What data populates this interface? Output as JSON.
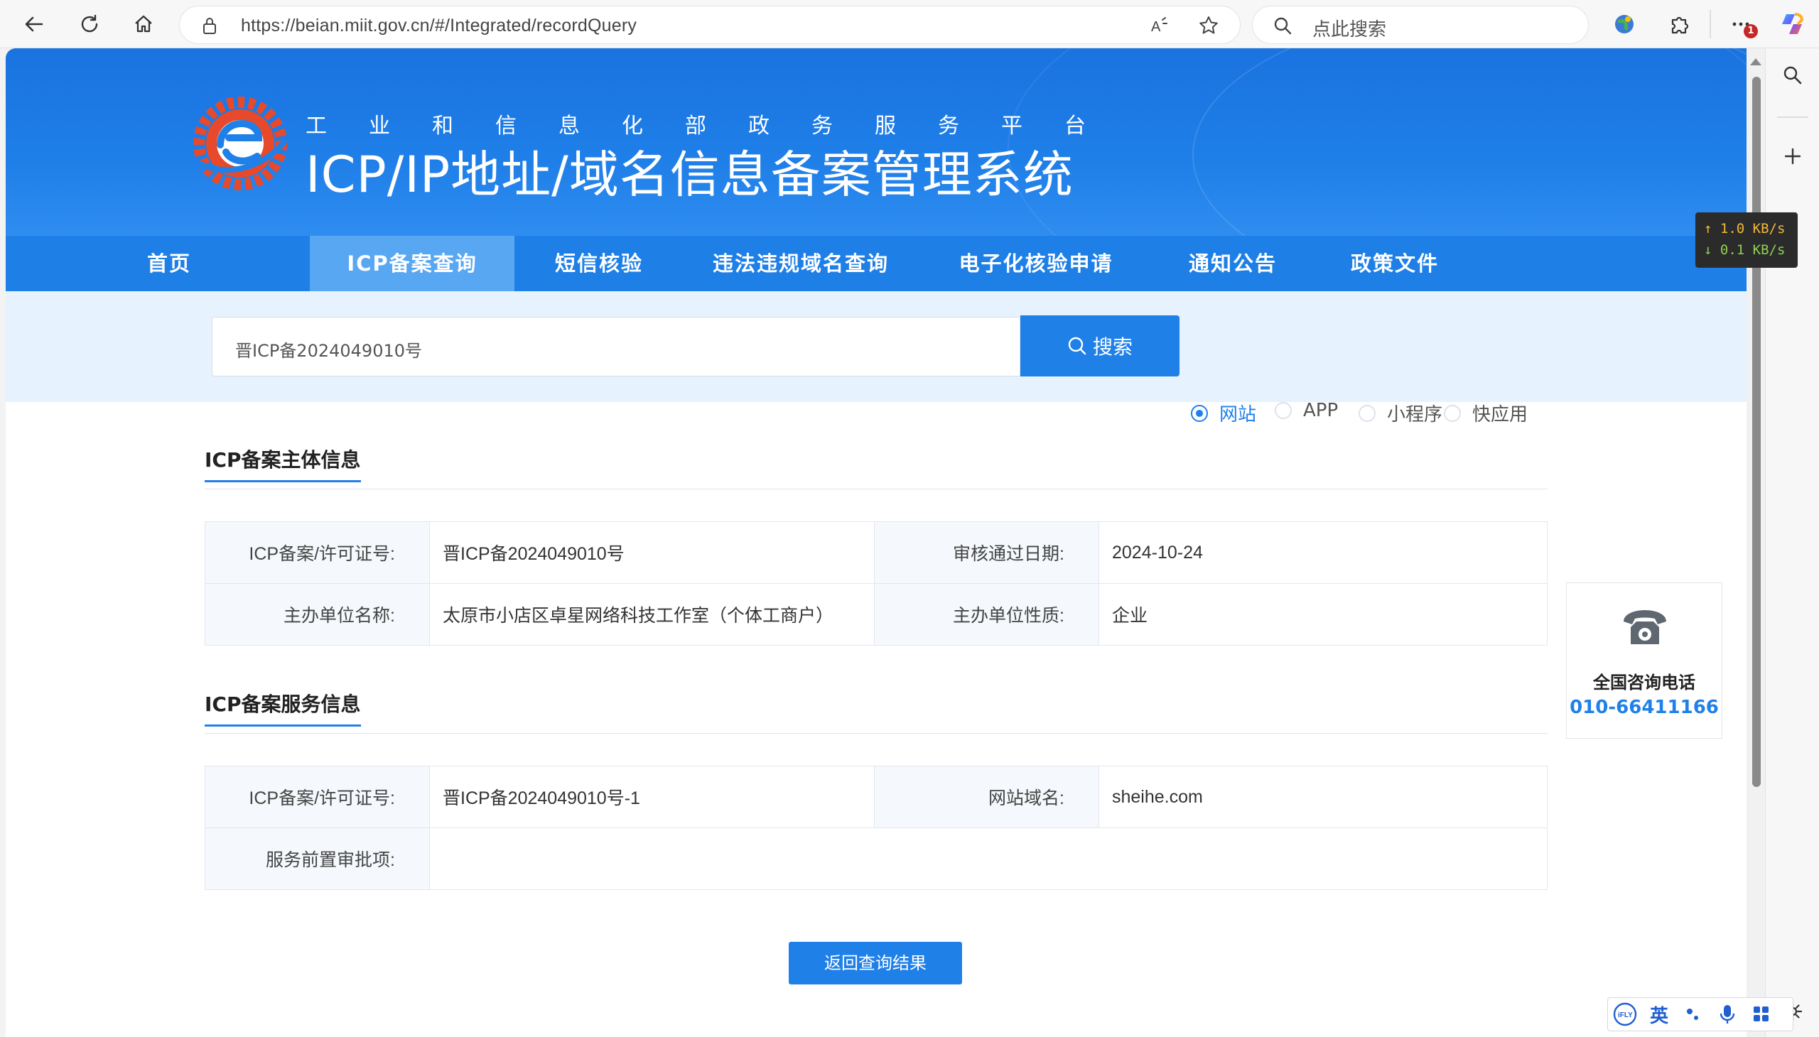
{
  "browser": {
    "url": "https://beian.miit.gov.cn/#/Integrated/recordQuery",
    "search_placeholder": "点此搜索",
    "notification_count": "1"
  },
  "header": {
    "subtitle": "工业和信息化部政务服务平台",
    "title": "ICP/IP地址/域名信息备案管理系统"
  },
  "nav": {
    "items": [
      {
        "label": "首页"
      },
      {
        "label": "ICP备案查询"
      },
      {
        "label": "短信核验"
      },
      {
        "label": "违法违规域名查询"
      },
      {
        "label": "电子化核验申请"
      },
      {
        "label": "通知公告"
      },
      {
        "label": "政策文件"
      }
    ],
    "active": "ICP备案查询"
  },
  "search": {
    "value": "晋ICP备2024049010号",
    "button_label": "搜索",
    "options": [
      "网站",
      "APP",
      "小程序",
      "快应用"
    ],
    "selected": "网站"
  },
  "subject_info": {
    "title": "ICP备案主体信息",
    "license_label": "ICP备案/许可证号:",
    "license_value": "晋ICP备2024049010号",
    "approval_date_label": "审核通过日期:",
    "approval_date_value": "2024-10-24",
    "org_name_label": "主办单位名称:",
    "org_name_value": "太原市小店区卓星网络科技工作室（个体工商户）",
    "org_type_label": "主办单位性质:",
    "org_type_value": "企业"
  },
  "service_info": {
    "title": "ICP备案服务信息",
    "license_label": "ICP备案/许可证号:",
    "license_value": "晋ICP备2024049010号-1",
    "domain_label": "网站域名:",
    "domain_value": "sheihe.com",
    "pre_approval_label": "服务前置审批项:",
    "pre_approval_value": ""
  },
  "back_button": "返回查询结果",
  "hotline": {
    "title": "全国咨询电话",
    "number": "010-66411166"
  },
  "netspeed": {
    "up": "↑ 1.0 KB/s",
    "down": "↓ 0.1 KB/s"
  },
  "ime": {
    "lang": "英"
  },
  "colors": {
    "primary": "#1f80e8",
    "header": "#1a73e0",
    "nav_active": "#58a7f3",
    "search_bg": "#e6f2fd"
  }
}
